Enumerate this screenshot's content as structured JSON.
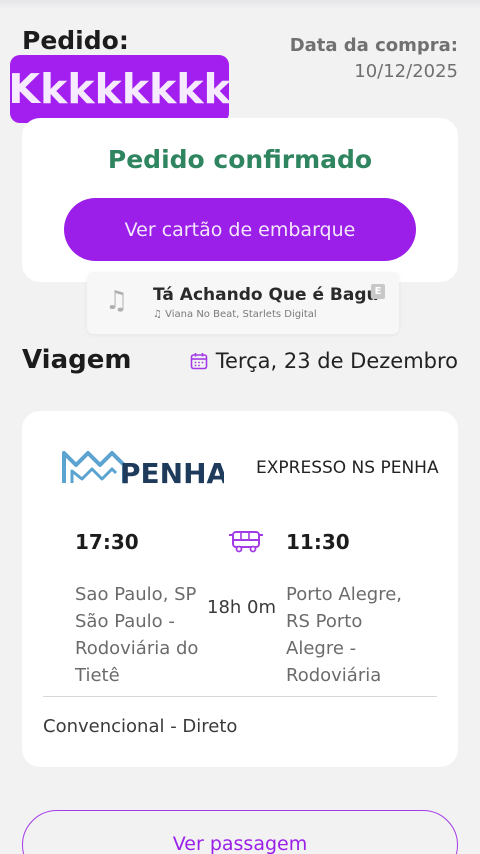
{
  "order": {
    "label": "Pedido:",
    "code": "Kkkkkkkk",
    "purchase_label": "Data da compra:",
    "purchase_date": "10/12/2025"
  },
  "confirmation": {
    "title": "Pedido confirmado",
    "boarding_button": "Ver cartão de embarque"
  },
  "music": {
    "title": "Tá Achando Que é Bagu",
    "artist": "Viana No Beat, Starlets Digital",
    "explicit_badge": "E"
  },
  "trip": {
    "label": "Viagem",
    "date": "Terça, 23 de Dezembro",
    "date_icon": "calendar-icon",
    "logo_text": "PENHA",
    "company": "EXPRESSO NS PENHA",
    "departure_time": "17:30",
    "arrival_time": "11:30",
    "departure_place": "Sao Paulo, SP São Paulo - Rodoviária do Tietê",
    "arrival_place": "Porto Alegre, RS Porto Alegre - Rodoviária",
    "duration": "18h 0m",
    "service": "Convencional - Direto",
    "bus_icon": "bus-icon"
  },
  "actions": {
    "ticket_button": "Ver passagem"
  },
  "colors": {
    "accent": "#9b1fe8",
    "confirm_green": "#2e8560",
    "logo_blue": "#5ba3d0",
    "logo_navy": "#1f3b5c"
  }
}
